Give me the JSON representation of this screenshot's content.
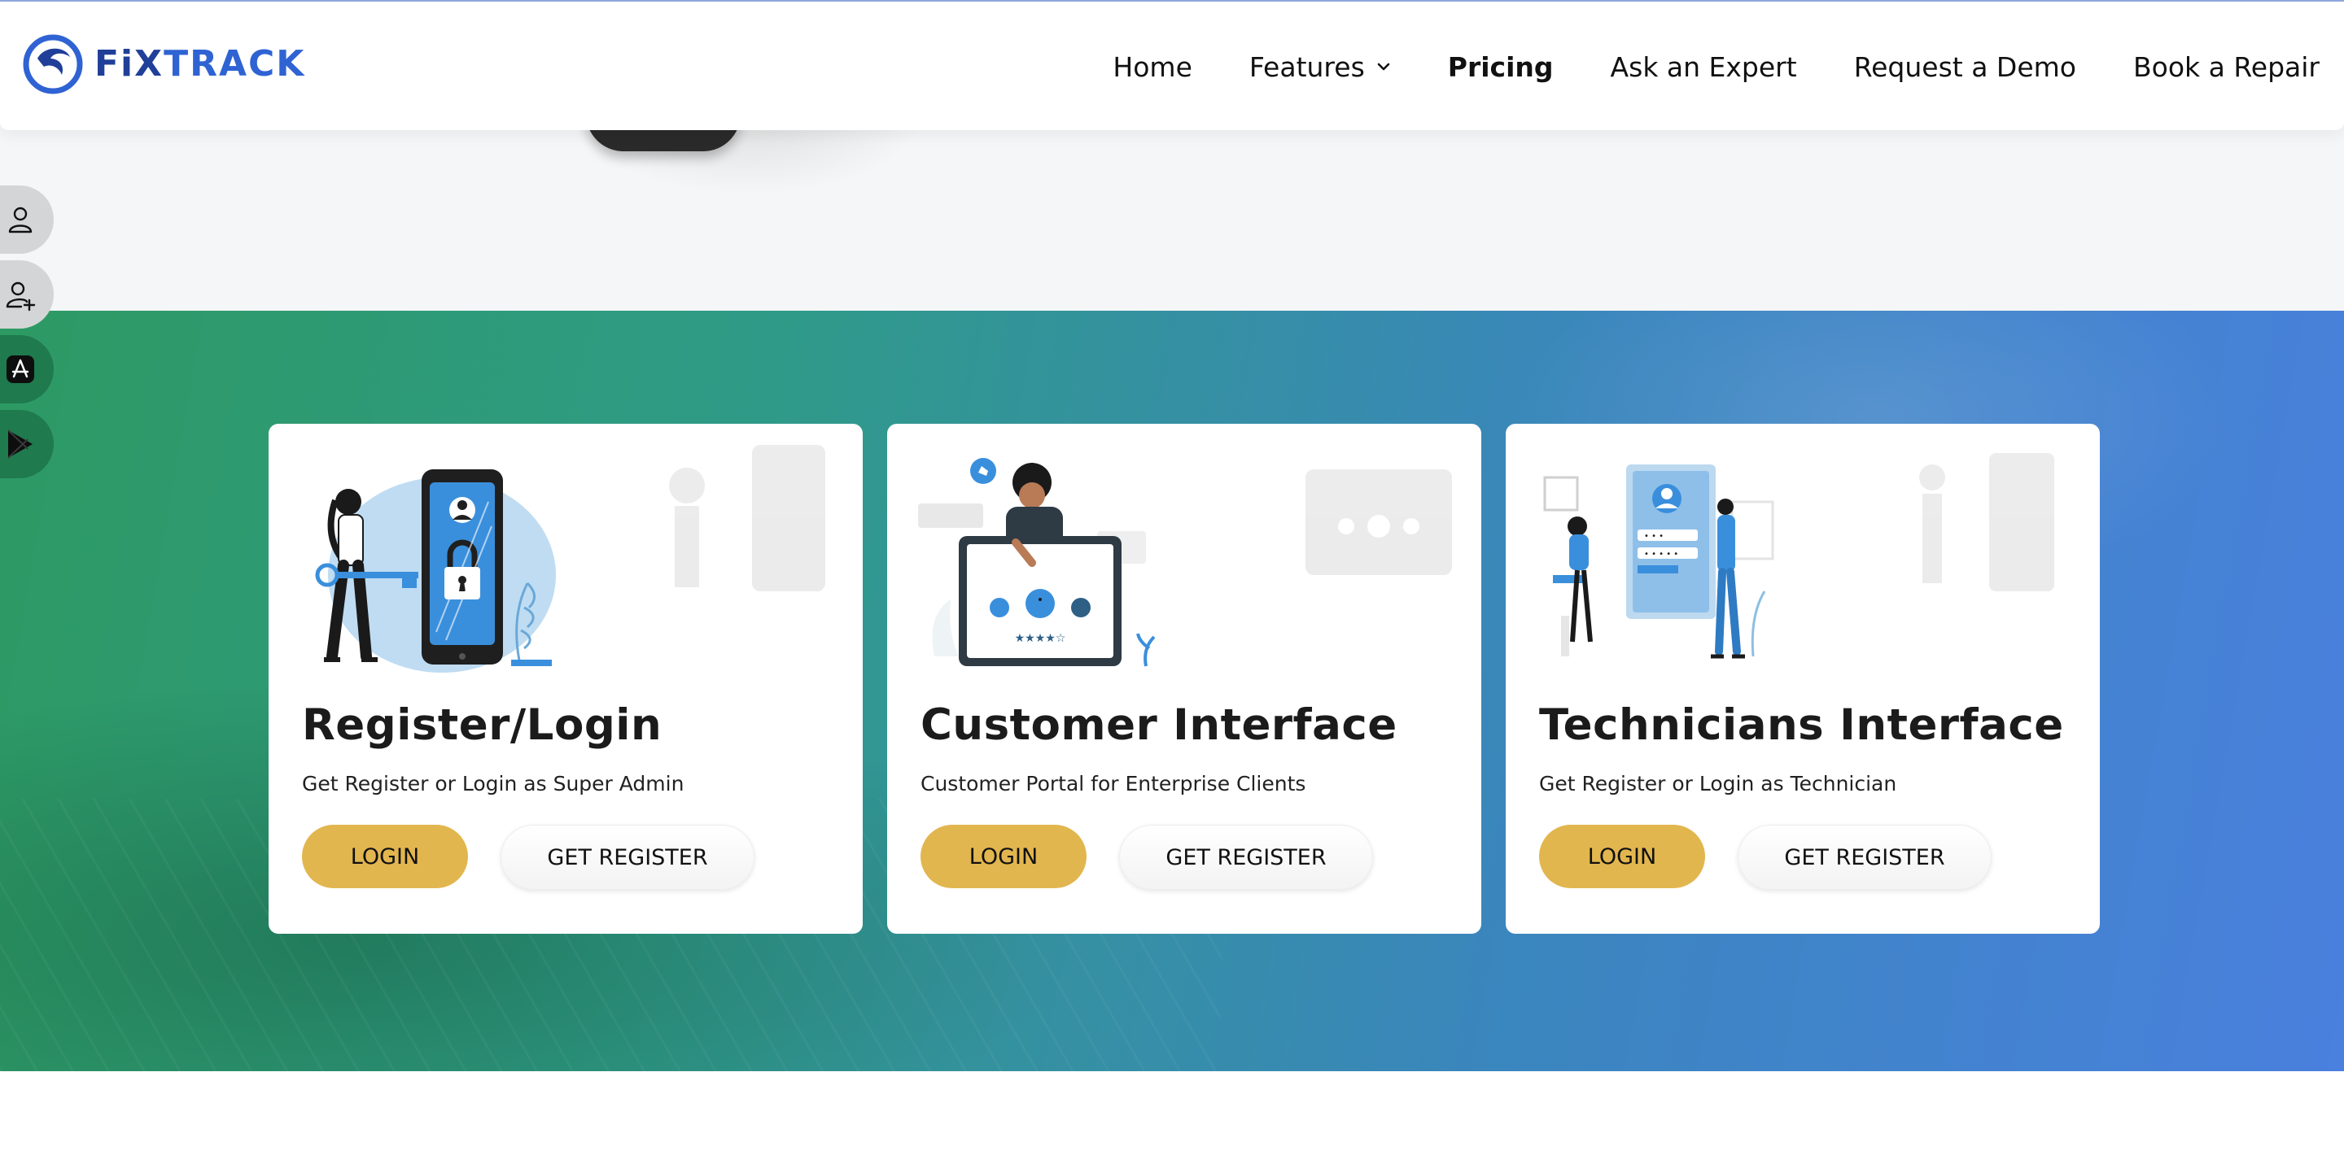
{
  "brand": {
    "name_prefix": "FiX",
    "name_suffix": "TRACK",
    "primary_color": "#2f63d3",
    "dark_color": "#1f3f98"
  },
  "nav": {
    "items": [
      {
        "label": "Home"
      },
      {
        "label": "Features"
      },
      {
        "label": "Pricing"
      },
      {
        "label": "Ask an Expert"
      },
      {
        "label": "Request a Demo"
      },
      {
        "label": "Book a Repair"
      }
    ]
  },
  "sidebar": {
    "buttons": [
      {
        "icon": "user-icon"
      },
      {
        "icon": "user-plus-icon"
      },
      {
        "icon": "app-store-icon"
      },
      {
        "icon": "google-play-icon"
      }
    ]
  },
  "cards": [
    {
      "title": "Register/Login",
      "subtitle": "Get Register or Login as Super Admin",
      "login_label": "LOGIN",
      "register_label": "GET REGISTER",
      "illustration": "woman-with-key-and-phone-lock-illustration"
    },
    {
      "title": "Customer Interface",
      "subtitle": "Customer Portal for Enterprise Clients",
      "login_label": "LOGIN",
      "register_label": "GET REGISTER",
      "illustration": "customer-feedback-tablet-illustration"
    },
    {
      "title": "Technicians Interface",
      "subtitle": "Get Register or Login as Technician",
      "login_label": "LOGIN",
      "register_label": "GET REGISTER",
      "illustration": "technician-profile-screen-illustration"
    }
  ],
  "colors": {
    "login_button": "#e2b64f",
    "gradient_start": "#2d9a63",
    "gradient_end": "#4a80de"
  }
}
